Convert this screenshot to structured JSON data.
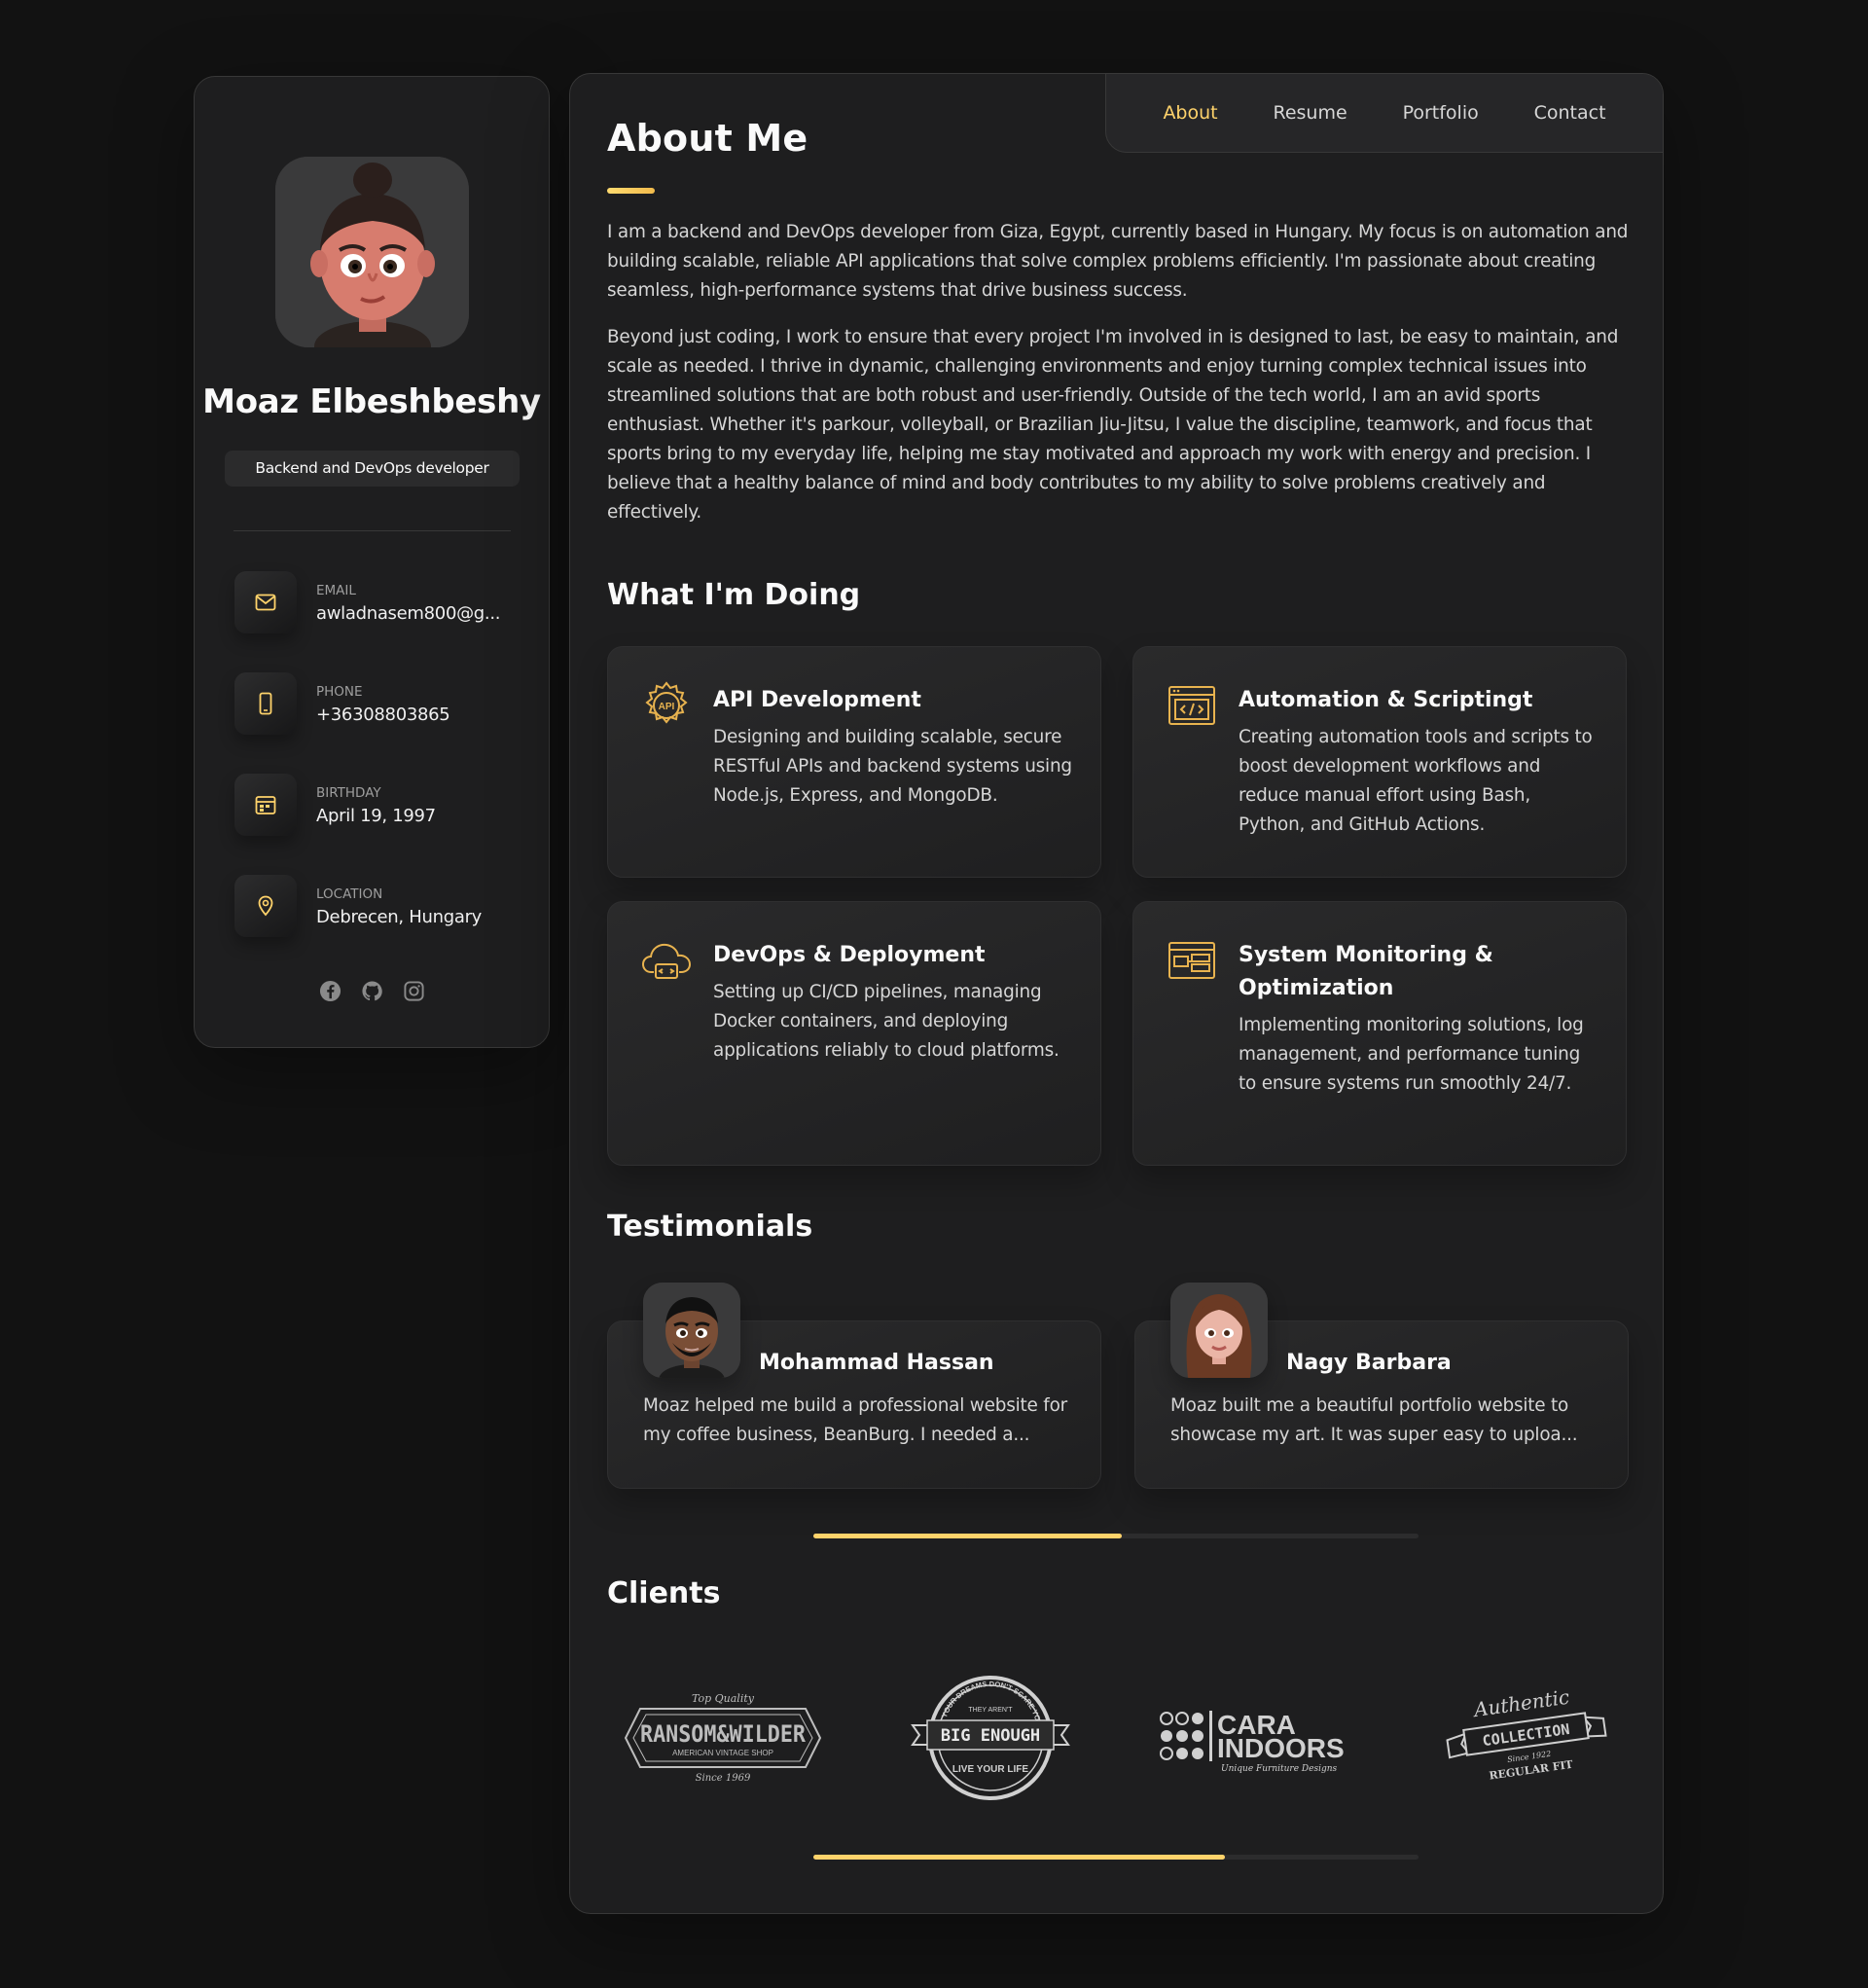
{
  "profile": {
    "name": "Moaz Elbeshbeshy",
    "title": "Backend and DevOps developer",
    "contacts": [
      {
        "label": "Email",
        "value": "awladnasem800@g...",
        "icon": "mail-icon"
      },
      {
        "label": "Phone",
        "value": "+36308803865",
        "icon": "phone-icon"
      },
      {
        "label": "Birthday",
        "value": "April 19, 1997",
        "icon": "calendar-icon"
      },
      {
        "label": "Location",
        "value": "Debrecen, Hungary",
        "icon": "location-pin-icon"
      }
    ],
    "socials": [
      "facebook-icon",
      "github-icon",
      "instagram-icon"
    ]
  },
  "nav": {
    "items": [
      "About",
      "Resume",
      "Portfolio",
      "Contact"
    ],
    "active": "About"
  },
  "about": {
    "heading": "About Me",
    "paragraphs": [
      "I am a backend and DevOps developer from Giza, Egypt, currently based in Hungary. My focus is on automation and building scalable, reliable API applications that solve complex problems efficiently. I'm passionate about creating seamless, high-performance systems that drive business success.",
      "Beyond just coding, I work to ensure that every project I'm involved in is designed to last, be easy to maintain, and scale as needed. I thrive in dynamic, challenging environments and enjoy turning complex technical issues into streamlined solutions that are both robust and user-friendly. Outside of the tech world, I am an avid sports enthusiast. Whether it's parkour, volleyball, or Brazilian Jiu-Jitsu, I value the discipline, teamwork, and focus that sports bring to my everyday life, helping me stay motivated and approach my work with energy and precision. I believe that a healthy balance of mind and body contributes to my ability to solve problems creatively and effectively."
    ]
  },
  "services": {
    "heading": "What I'm Doing",
    "items": [
      {
        "title": "API Development",
        "text": "Designing and building scalable, secure RESTful APIs and backend systems using Node.js, Express, and MongoDB.",
        "icon": "api-gear-icon"
      },
      {
        "title": "Automation & Scriptingt",
        "text": "Creating automation tools and scripts to boost development workflows and reduce manual effort using Bash, Python, and GitHub Actions.",
        "icon": "code-window-icon"
      },
      {
        "title": "DevOps & Deployment",
        "text": "Setting up CI/CD pipelines, managing Docker containers, and deploying applications reliably to cloud platforms.",
        "icon": "cloud-code-icon"
      },
      {
        "title": "System Monitoring & Optimization",
        "text": "Implementing monitoring solutions, log management, and performance tuning to ensure systems run smoothly 24/7.",
        "icon": "monitor-window-icon"
      }
    ]
  },
  "testimonials": {
    "heading": "Testimonials",
    "items": [
      {
        "name": "Mohammad Hassan",
        "text": "Moaz helped me build a professional website for my coffee business, BeanBurg. I needed a..."
      },
      {
        "name": "Nagy Barbara",
        "text": "Moaz built me a beautiful portfolio website to showcase my art. It was super easy to uploa..."
      }
    ],
    "scroll_progress": 0.51
  },
  "clients": {
    "heading": "Clients",
    "logos": [
      {
        "name": "ransom-wilder-logo",
        "line1": "Top Quality",
        "line2": "RANSOM&WILDER",
        "line3": "AMERICAN VINTAGE SHOP",
        "line4": "Since 1969"
      },
      {
        "name": "big-enough-logo",
        "line1": "IF YOUR DREAMS DON'T SCARE YOU",
        "line2": "THEY AREN'T",
        "line3": "BIG ENOUGH",
        "line4": "LIVE YOUR LIFE"
      },
      {
        "name": "cara-indoors-logo",
        "line1": "CARA",
        "line2": "INDOORS",
        "line3": "Unique Furniture Designs"
      },
      {
        "name": "authentic-collection-logo",
        "line1": "Authentic",
        "line2": "COLLECTION",
        "line3": "Since 1922",
        "line4": "REGULAR FIT"
      }
    ],
    "scroll_progress": 0.68
  },
  "colors": {
    "accent": "#ffd36b",
    "background": "#121212",
    "card": "#1e1e1f",
    "text": "#fafafa",
    "muted": "#d6d6d6"
  }
}
